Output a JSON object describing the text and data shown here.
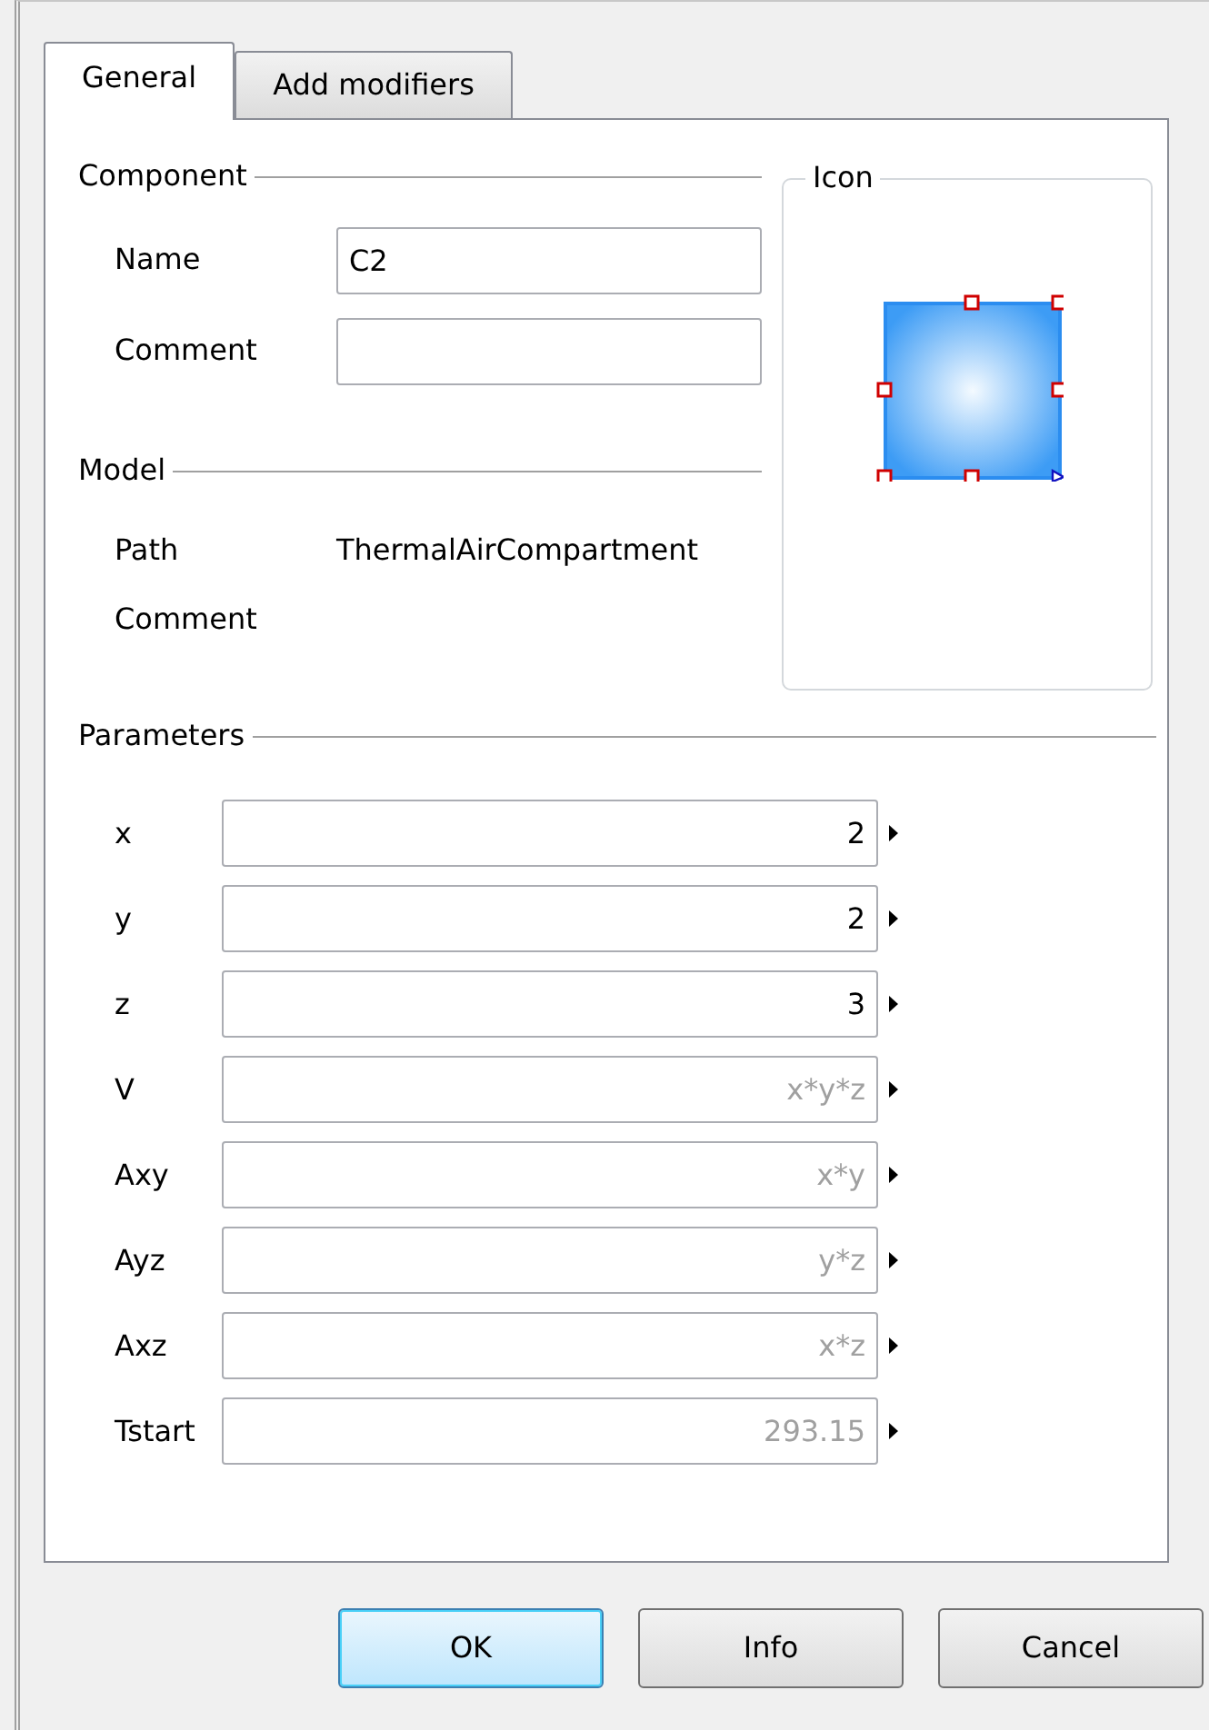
{
  "tabs": [
    {
      "label": "General",
      "selected": true
    },
    {
      "label": "Add modifiers",
      "selected": false
    }
  ],
  "component": {
    "title": "Component",
    "fields": [
      {
        "label": "Name",
        "value": "C2"
      },
      {
        "label": "Comment"
      }
    ]
  },
  "icon_group": {
    "title": "Icon"
  },
  "model": {
    "title": "Model",
    "rows": [
      {
        "label": "Path",
        "value": "ThermalAirCompartment"
      },
      {
        "label": "Comment"
      }
    ]
  },
  "parameters": {
    "title": "Parameters",
    "rows": [
      {
        "label": "x",
        "value": "2"
      },
      {
        "label": "y",
        "value": "2"
      },
      {
        "label": "z",
        "value": "3"
      },
      {
        "label": "V",
        "placeholder": "x*y*z"
      },
      {
        "label": "Axy",
        "placeholder": "x*y"
      },
      {
        "label": "Ayz",
        "placeholder": "y*z"
      },
      {
        "label": "Axz",
        "placeholder": "x*z"
      },
      {
        "label": "Tstart",
        "placeholder": "293.15"
      }
    ]
  },
  "buttons": [
    {
      "label": "OK",
      "default": true
    },
    {
      "label": "Info",
      "default": false
    },
    {
      "label": "Cancel",
      "default": false
    }
  ]
}
